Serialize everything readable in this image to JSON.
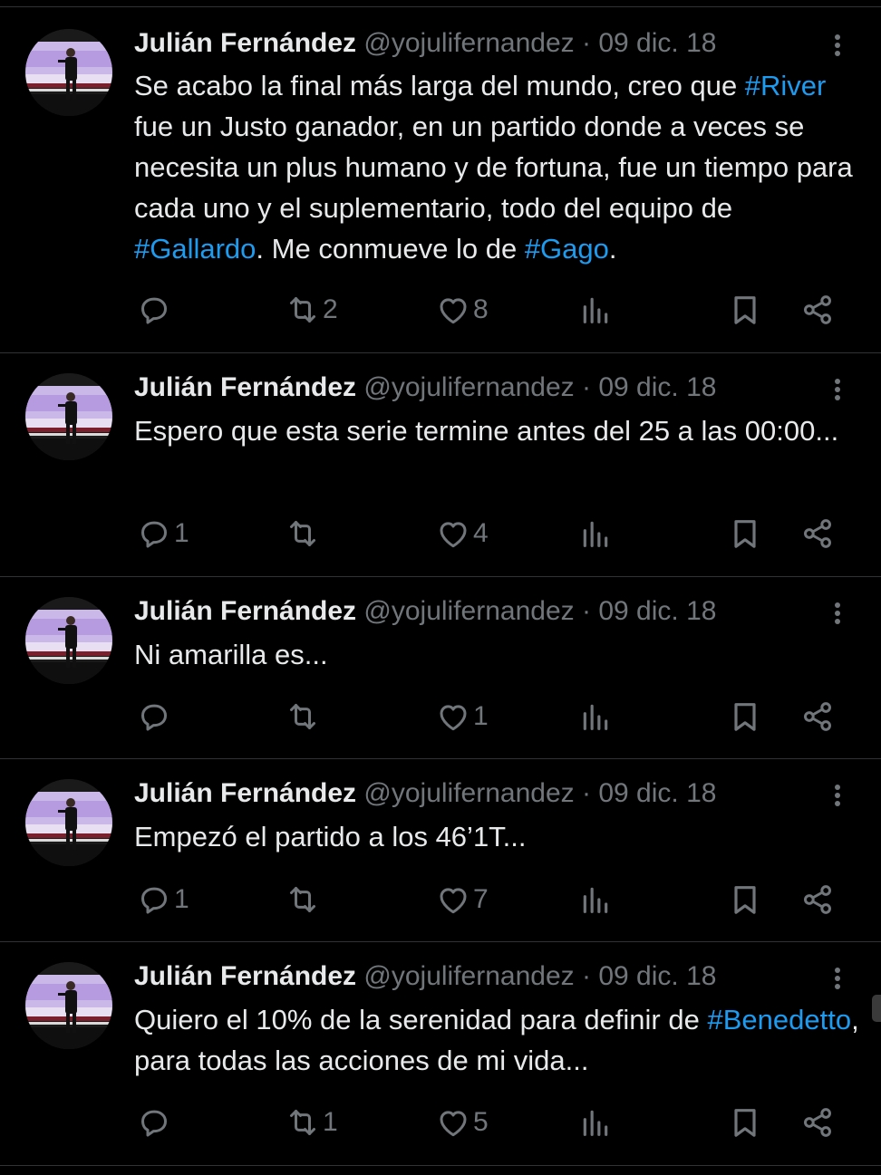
{
  "tweets": [
    {
      "author": "Julián Fernández",
      "handle": "@yojulifernandez",
      "date": "· 09 dic. 18",
      "text_segments": [
        {
          "t": "Se acabo la final más larga del mundo, creo que "
        },
        {
          "t": "#River",
          "tag": true
        },
        {
          "t": " fue un Justo ganador, en un partido donde a veces se necesita un plus humano y de fortuna, fue un tiempo para cada uno y el suplementario, todo del equipo de "
        },
        {
          "t": "#Gallardo",
          "tag": true
        },
        {
          "t": ". Me conmueve lo de "
        },
        {
          "t": "#Gago",
          "tag": true
        },
        {
          "t": "."
        }
      ],
      "replies": "",
      "retweets": "2",
      "likes": "8"
    },
    {
      "author": "Julián Fernández",
      "handle": "@yojulifernandez",
      "date": "· 09 dic. 18",
      "text_segments": [
        {
          "t": "Espero que esta serie termine antes del 25 a las 00:00..."
        }
      ],
      "replies": "1",
      "retweets": "",
      "likes": "4"
    },
    {
      "author": "Julián Fernández",
      "handle": "@yojulifernandez",
      "date": "· 09 dic. 18",
      "text_segments": [
        {
          "t": "Ni amarilla es..."
        }
      ],
      "replies": "",
      "retweets": "",
      "likes": "1"
    },
    {
      "author": "Julián Fernández",
      "handle": "@yojulifernandez",
      "date": "· 09 dic. 18",
      "text_segments": [
        {
          "t": "Empezó el partido a los 46’1T..."
        }
      ],
      "replies": "1",
      "retweets": "",
      "likes": "7"
    },
    {
      "author": "Julián Fernández",
      "handle": "@yojulifernandez",
      "date": "· 09 dic. 18",
      "text_segments": [
        {
          "t": "Quiero el 10% de la serenidad para definir de "
        },
        {
          "t": "#Benedetto",
          "tag": true
        },
        {
          "t": ", para todas las acciones de mi vida..."
        }
      ],
      "replies": "",
      "retweets": "1",
      "likes": "5"
    }
  ],
  "icons": {
    "reply": "reply-icon",
    "retweet": "retweet-icon",
    "like": "heart-icon",
    "views": "views-chart-icon",
    "bookmark": "bookmark-icon",
    "share": "share-icon",
    "more": "more-vertical-icon"
  },
  "colors": {
    "background": "#000000",
    "text": "#e7e9ea",
    "muted": "#71767b",
    "hashtag": "#1d9bf0",
    "divider": "#2f3336"
  }
}
